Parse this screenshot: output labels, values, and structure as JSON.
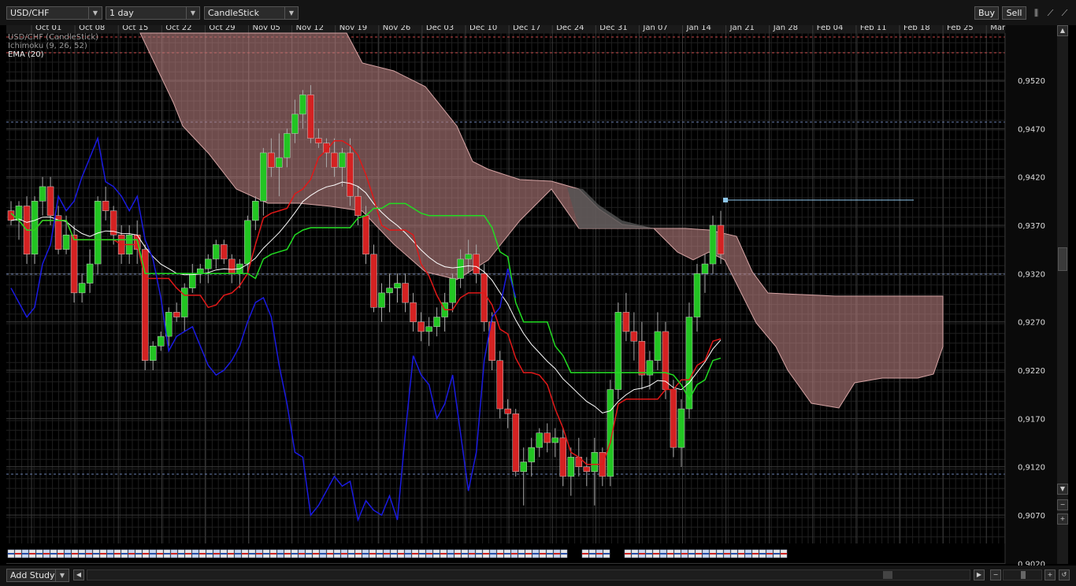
{
  "toolbar": {
    "symbol": "USD/CHF",
    "timeframe": "1 day",
    "chart_style": "CandleStick",
    "buy_label": "Buy",
    "sell_label": "Sell"
  },
  "legend": {
    "symbol_line": "USD/CHF (CandleStick)",
    "ichimoku_line": "Ichimoku (9, 26, 52)",
    "ema_line": "EMA (20)"
  },
  "bottom": {
    "add_study_label": "Add Study"
  },
  "chart_data": {
    "type": "candlestick",
    "x_labels": [
      "Oct 01",
      "Oct 08",
      "Oct 15",
      "Oct 22",
      "Oct 29",
      "Nov 05",
      "Nov 12",
      "Nov 19",
      "Nov 26",
      "Dec 03",
      "Dec 10",
      "Dec 17",
      "Dec 24",
      "Dec 31",
      "Jan 07",
      "Jan 14",
      "Jan 21",
      "Jan 28",
      "Feb 04",
      "Feb 11",
      "Feb 18",
      "Feb 25",
      "Mar"
    ],
    "y_ticks": [
      "0,9520",
      "0,9470",
      "0,9420",
      "0,9370",
      "0,9320",
      "0,9270",
      "0,9220",
      "0,9170",
      "0,9120",
      "0,9070",
      "0,9020"
    ],
    "ylim": [
      0.902,
      0.957
    ],
    "candles": [
      [
        0.9385,
        0.9395,
        0.937,
        0.9375
      ],
      [
        0.9375,
        0.9395,
        0.9355,
        0.939
      ],
      [
        0.939,
        0.94,
        0.933,
        0.934
      ],
      [
        0.934,
        0.94,
        0.933,
        0.9395
      ],
      [
        0.9395,
        0.942,
        0.938,
        0.941
      ],
      [
        0.941,
        0.942,
        0.937,
        0.938
      ],
      [
        0.938,
        0.939,
        0.934,
        0.9345
      ],
      [
        0.9345,
        0.938,
        0.934,
        0.936
      ],
      [
        0.936,
        0.937,
        0.929,
        0.93
      ],
      [
        0.93,
        0.932,
        0.929,
        0.931
      ],
      [
        0.931,
        0.9345,
        0.93,
        0.933
      ],
      [
        0.933,
        0.94,
        0.932,
        0.9395
      ],
      [
        0.9395,
        0.941,
        0.9375,
        0.9385
      ],
      [
        0.9385,
        0.939,
        0.935,
        0.936
      ],
      [
        0.936,
        0.937,
        0.933,
        0.934
      ],
      [
        0.934,
        0.937,
        0.933,
        0.936
      ],
      [
        0.936,
        0.9375,
        0.933,
        0.9345
      ],
      [
        0.9345,
        0.935,
        0.922,
        0.923
      ],
      [
        0.923,
        0.925,
        0.922,
        0.9245
      ],
      [
        0.9245,
        0.926,
        0.924,
        0.9255
      ],
      [
        0.9255,
        0.9285,
        0.9245,
        0.928
      ],
      [
        0.928,
        0.929,
        0.927,
        0.9275
      ],
      [
        0.9275,
        0.931,
        0.926,
        0.9305
      ],
      [
        0.9305,
        0.933,
        0.93,
        0.932
      ],
      [
        0.932,
        0.933,
        0.931,
        0.9325
      ],
      [
        0.9325,
        0.934,
        0.931,
        0.9335
      ],
      [
        0.9335,
        0.9355,
        0.9325,
        0.935
      ],
      [
        0.935,
        0.9355,
        0.933,
        0.9335
      ],
      [
        0.9335,
        0.934,
        0.931,
        0.932
      ],
      [
        0.932,
        0.9335,
        0.9305,
        0.933
      ],
      [
        0.933,
        0.938,
        0.932,
        0.9375
      ],
      [
        0.9375,
        0.94,
        0.9365,
        0.9395
      ],
      [
        0.9395,
        0.945,
        0.938,
        0.9445
      ],
      [
        0.9445,
        0.946,
        0.942,
        0.943
      ],
      [
        0.943,
        0.9465,
        0.94,
        0.944
      ],
      [
        0.944,
        0.947,
        0.943,
        0.9465
      ],
      [
        0.9465,
        0.95,
        0.9455,
        0.9485
      ],
      [
        0.9485,
        0.951,
        0.947,
        0.9505
      ],
      [
        0.9505,
        0.9515,
        0.9455,
        0.946
      ],
      [
        0.946,
        0.947,
        0.945,
        0.9455
      ],
      [
        0.9455,
        0.946,
        0.943,
        0.9445
      ],
      [
        0.9445,
        0.946,
        0.942,
        0.943
      ],
      [
        0.943,
        0.945,
        0.941,
        0.9445
      ],
      [
        0.9445,
        0.946,
        0.939,
        0.94
      ],
      [
        0.94,
        0.941,
        0.937,
        0.938
      ],
      [
        0.938,
        0.939,
        0.933,
        0.934
      ],
      [
        0.934,
        0.935,
        0.928,
        0.9285
      ],
      [
        0.9285,
        0.931,
        0.927,
        0.93
      ],
      [
        0.93,
        0.932,
        0.928,
        0.9305
      ],
      [
        0.9305,
        0.932,
        0.929,
        0.931
      ],
      [
        0.931,
        0.932,
        0.928,
        0.929
      ],
      [
        0.929,
        0.93,
        0.926,
        0.927
      ],
      [
        0.927,
        0.928,
        0.925,
        0.926
      ],
      [
        0.926,
        0.9275,
        0.9245,
        0.9265
      ],
      [
        0.9265,
        0.9285,
        0.9255,
        0.9275
      ],
      [
        0.9275,
        0.93,
        0.926,
        0.929
      ],
      [
        0.929,
        0.932,
        0.928,
        0.9315
      ],
      [
        0.9315,
        0.9345,
        0.9305,
        0.9335
      ],
      [
        0.9335,
        0.9355,
        0.932,
        0.934
      ],
      [
        0.934,
        0.935,
        0.931,
        0.932
      ],
      [
        0.932,
        0.933,
        0.926,
        0.927
      ],
      [
        0.927,
        0.928,
        0.922,
        0.923
      ],
      [
        0.923,
        0.924,
        0.917,
        0.918
      ],
      [
        0.918,
        0.919,
        0.916,
        0.9175
      ],
      [
        0.9175,
        0.918,
        0.911,
        0.9115
      ],
      [
        0.9115,
        0.914,
        0.908,
        0.9125
      ],
      [
        0.9125,
        0.915,
        0.911,
        0.914
      ],
      [
        0.914,
        0.916,
        0.913,
        0.9155
      ],
      [
        0.9155,
        0.9165,
        0.9135,
        0.9145
      ],
      [
        0.9145,
        0.916,
        0.913,
        0.915
      ],
      [
        0.915,
        0.916,
        0.91,
        0.911
      ],
      [
        0.911,
        0.914,
        0.909,
        0.913
      ],
      [
        0.913,
        0.915,
        0.911,
        0.912
      ],
      [
        0.912,
        0.913,
        0.91,
        0.9115
      ],
      [
        0.9115,
        0.915,
        0.908,
        0.9135
      ],
      [
        0.9135,
        0.914,
        0.91,
        0.911
      ],
      [
        0.911,
        0.921,
        0.91,
        0.92
      ],
      [
        0.92,
        0.929,
        0.919,
        0.928
      ],
      [
        0.928,
        0.93,
        0.925,
        0.926
      ],
      [
        0.926,
        0.928,
        0.923,
        0.925
      ],
      [
        0.925,
        0.927,
        0.92,
        0.9215
      ],
      [
        0.9215,
        0.924,
        0.92,
        0.923
      ],
      [
        0.923,
        0.928,
        0.922,
        0.926
      ],
      [
        0.926,
        0.927,
        0.919,
        0.92
      ],
      [
        0.92,
        0.921,
        0.913,
        0.914
      ],
      [
        0.914,
        0.919,
        0.912,
        0.918
      ],
      [
        0.918,
        0.929,
        0.917,
        0.9275
      ],
      [
        0.9275,
        0.933,
        0.926,
        0.932
      ],
      [
        0.932,
        0.934,
        0.93,
        0.933
      ],
      [
        0.933,
        0.938,
        0.932,
        0.937
      ],
      [
        0.937,
        0.9385,
        0.933,
        0.934
      ]
    ]
  },
  "colors": {
    "up": "#22c522",
    "down": "#d42222",
    "cloud": "#b87e7e",
    "grid": "#3a3a3a",
    "ema": "#ffffff",
    "tenkan": "#e01818",
    "kijun": "#22dd22",
    "chikou": "#1a1ae0"
  }
}
